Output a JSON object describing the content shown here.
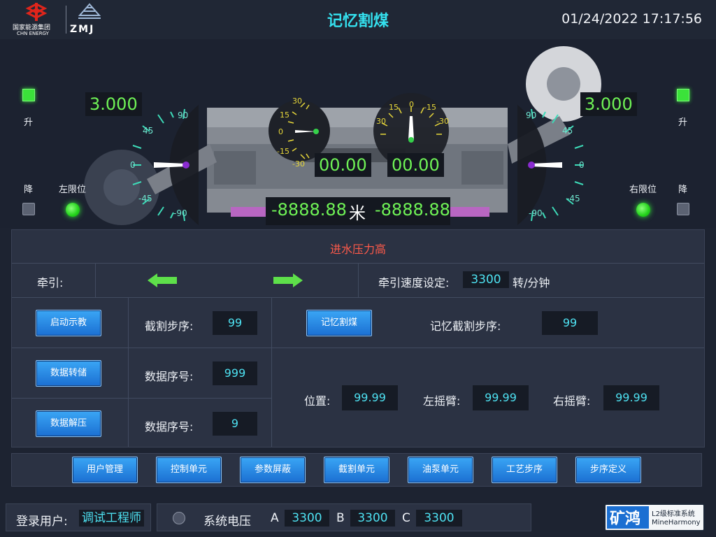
{
  "header": {
    "org_name_cn": "国家能源集团",
    "org_name_en": "CHN ENERGY",
    "brand": "ZMJ",
    "title": "记忆割煤",
    "datetime": "01/24/2022  17:17:56"
  },
  "stage": {
    "left": {
      "raise_label": "升",
      "lower_label": "降",
      "limit_label": "左限位",
      "height_value": "3.000",
      "gauge_labels": [
        "90",
        "45",
        "0",
        "-45",
        "-90"
      ]
    },
    "right": {
      "raise_label": "升",
      "lower_label": "降",
      "limit_label": "右限位",
      "height_value": "3.000",
      "gauge_labels": [
        "90",
        "45",
        "0",
        "-45",
        "-90"
      ]
    },
    "pitch": {
      "value": "00.00",
      "labels": [
        "30",
        "15",
        "0",
        "-15",
        "-30"
      ]
    },
    "roll": {
      "value": "00.00",
      "labels": [
        "15",
        "0",
        "-15",
        "30",
        "-30"
      ]
    },
    "position": {
      "left": "-8888.88",
      "unit": "米",
      "right": "-8888.88"
    }
  },
  "panel": {
    "alarm": "进水压力高",
    "traction_label": "牵引:",
    "speed_label": "牵引速度设定:",
    "speed_value": "3300",
    "speed_unit": "转/分钟",
    "btn_start_teach": "启动示教",
    "btn_data_dump": "数据转储",
    "btn_data_unpack": "数据解压",
    "btn_memory_cut": "记忆割煤",
    "cut_step_label": "截割步序:",
    "cut_step_value": "99",
    "data_seq_label": "数据序号:",
    "data_seq_value": "999",
    "data_seq2_label": "数据序号:",
    "data_seq2_value": "9",
    "mem_step_label": "记忆截割步序:",
    "mem_step_value": "99",
    "pos_label": "位置:",
    "pos_value": "99.99",
    "left_arm_label": "左摇臂:",
    "left_arm_value": "99.99",
    "right_arm_label": "右摇臂:",
    "right_arm_value": "99.99"
  },
  "nav": [
    "用户管理",
    "控制单元",
    "参数屏蔽",
    "截割单元",
    "油泵单元",
    "工艺步序",
    "步序定义"
  ],
  "footer": {
    "user_label": "登录用户:",
    "user_value": "调试工程师",
    "voltage_label": "系统电压",
    "a_label": "A",
    "a_value": "3300",
    "b_label": "B",
    "b_value": "3300",
    "c_label": "C",
    "c_value": "3300",
    "product_cn": "矿鸿",
    "product_level": "L2级标准系统",
    "product_en": "MineHarmony"
  },
  "colors": {
    "accent": "#34e0ee",
    "lcd_green": "#6ff356",
    "button_blue": "#1b6fd2",
    "alarm_red": "#ff5a4a"
  }
}
